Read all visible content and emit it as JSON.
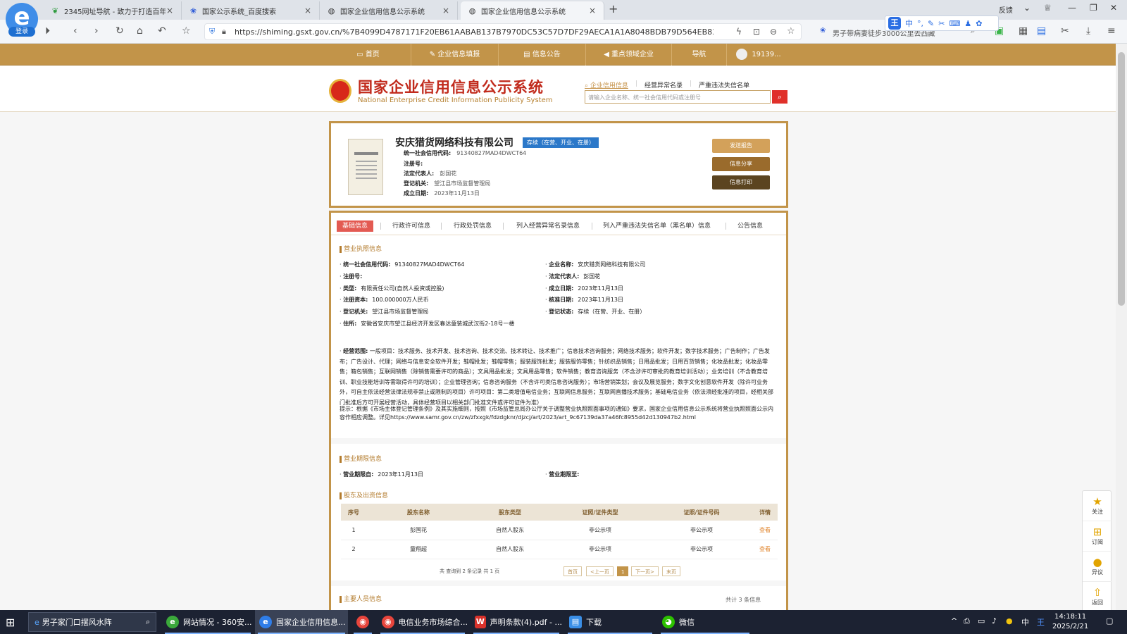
{
  "browser": {
    "tabs": [
      {
        "title": "2345网址导航 - 致力于打造百年",
        "icon": "leaf-icon"
      },
      {
        "title": "国家公示系统_百度搜索",
        "icon": "baidu-paw-icon"
      },
      {
        "title": "国家企业信用信息公示系统",
        "icon": "globe-icon"
      },
      {
        "title": "国家企业信用信息公示系统",
        "icon": "globe-icon",
        "active": true
      }
    ],
    "login_label": "登录",
    "feedback_label": "反馈",
    "url": "https://shiming.gsxt.gov.cn/%7B4099D4787171F20EB61AABAB137B7970DC53C57D7DF29AECA1A1A8048BDB79D564EB83F5B...",
    "search_text": "男子带病妻徒步3000公里去西藏",
    "ime_label": "中"
  },
  "site": {
    "nav": [
      "首页",
      "企业信息填报",
      "信息公告",
      "重点领域企业",
      "导航",
      "19139..."
    ],
    "title_cn": "国家企业信用信息公示系统",
    "title_en": "National Enterprise Credit Information Publicity System",
    "search_tabs": [
      "企业信用信息",
      "经营异常名录",
      "严重违法失信名单"
    ],
    "search_placeholder": "请输入企业名称、统一社会信用代码或注册号"
  },
  "company": {
    "name": "安庆猎货网络科技有限公司",
    "status": "存续（在营、开业、在册）",
    "credit_code_label": "统一社会信用代码:",
    "credit_code": "91340827MAD4DWCT64",
    "reg_no_label": "注册号:",
    "legal_rep_label": "法定代表人:",
    "legal_rep": "彭国花",
    "authority_label": "登记机关:",
    "authority": "望江县市场监督管理局",
    "est_date_label": "成立日期:",
    "est_date": "2023年11月13日",
    "buttons": [
      "发送报告",
      "信息分享",
      "信息打印"
    ]
  },
  "detail_tabs": [
    "基础信息",
    "行政许可信息",
    "行政处罚信息",
    "列入经营异常名录信息",
    "列入严重违法失信名单（黑名单）信息",
    "公告信息"
  ],
  "license": {
    "section_title": "营业执照信息",
    "left": [
      {
        "k": "统一社会信用代码:",
        "v": "91340827MAD4DWCT64"
      },
      {
        "k": "注册号:",
        "v": ""
      },
      {
        "k": "类型:",
        "v": "有限责任公司(自然人投资或控股)"
      },
      {
        "k": "注册资本:",
        "v": "100.000000万人民币"
      },
      {
        "k": "登记机关:",
        "v": "望江县市场监督管理局"
      },
      {
        "k": "住所:",
        "v": "安徽省安庆市望江县经济开发区春达童装城武汉街2-18号一楼"
      }
    ],
    "right": [
      {
        "k": "企业名称:",
        "v": "安庆猎货网络科技有限公司"
      },
      {
        "k": "法定代表人:",
        "v": "彭国花"
      },
      {
        "k": "成立日期:",
        "v": "2023年11月13日"
      },
      {
        "k": "核准日期:",
        "v": "2023年11月13日"
      },
      {
        "k": "登记状态:",
        "v": "存续（在营、开业、在册）"
      }
    ],
    "scope_label": "经营范围:",
    "scope": "一般项目：技术服务、技术开发、技术咨询、技术交流、技术转让、技术推广；信息技术咨询服务；网络技术服务；软件开发；数字技术服务；广告制作；广告发布；广告设计、代理；网络与信息安全软件开发；鞋帽批发；鞋帽零售；服装服饰批发；服装服饰零售；针纺织品销售；日用品批发；日用百货销售；化妆品批发；化妆品零售；箱包销售；互联网销售（除销售需要许可的商品）；文具用品批发；文具用品零售；软件销售；教育咨询服务（不含涉许可审批的教育培训活动）；业务培训（不含教育培训、职业技能培训等需取得许可的培训）；企业管理咨询；信息咨询服务（不含许可类信息咨询服务）；市场营销策划；会议及展览服务；数字文化创意软件开发（除许可业务外，可自主依法经营法律法规非禁止或限制的项目）许可项目：第二类增值电信业务；互联网信息服务；互联网直播技术服务；基础电信业务（依法须经批准的项目，经相关部门批准后方可开展经营活动，具体经营项目以相关部门批准文件或许可证件为准）",
    "tip": "提示：根据《市场主体登记管理条例》及其实施细则，按照《市场监管总局办公厅关于调整营业执照照面事项的通知》要求，国家企业信用信息公示系统将营业执照照面公示内容作相应调整。详见https://www.samr.gov.cn/zw/zfxxgk/fdzdgknr/djzcj/art/2023/art_9c67139da37a46fc8955d42d130947b2.html"
  },
  "term": {
    "section_title": "营业期限信息",
    "from_label": "营业期限自:",
    "from": "2023年11月13日",
    "to_label": "营业期限至:",
    "to": ""
  },
  "shareholders": {
    "section_title": "股东及出资信息",
    "columns": [
      "序号",
      "股东名称",
      "股东类型",
      "证照/证件类型",
      "证照/证件号码",
      "详情"
    ],
    "rows": [
      [
        "1",
        "彭国花",
        "自然人股东",
        "非公示项",
        "非公示项",
        "查看"
      ],
      [
        "2",
        "童翔超",
        "自然人股东",
        "非公示项",
        "非公示项",
        "查看"
      ]
    ],
    "pager_text": "共 查询到 2 条记录 共 1 页",
    "pager": [
      "首页",
      "<上一页",
      "1",
      "下一页>",
      "末页"
    ]
  },
  "personnel": {
    "section_title": "主要人员信息",
    "count_text": "共计 3 条信息"
  },
  "side_float": [
    "关注",
    "订阅",
    "异议",
    "返回"
  ],
  "taskbar": {
    "search": "男子家门口摆风水阵",
    "items": [
      "网站情况 - 360安...",
      "国家企业信用信息...",
      "",
      "电信业务市场综合...",
      "声明条款(4).pdf - ...",
      "下载",
      "微信"
    ],
    "ime": "中",
    "time": "14:18:11",
    "date": "2025/2/21"
  },
  "colors": {
    "brand": "#c29449",
    "title_red": "#c12a1c",
    "status_blue": "#2b78c9",
    "active_tab": "#e35a52"
  }
}
